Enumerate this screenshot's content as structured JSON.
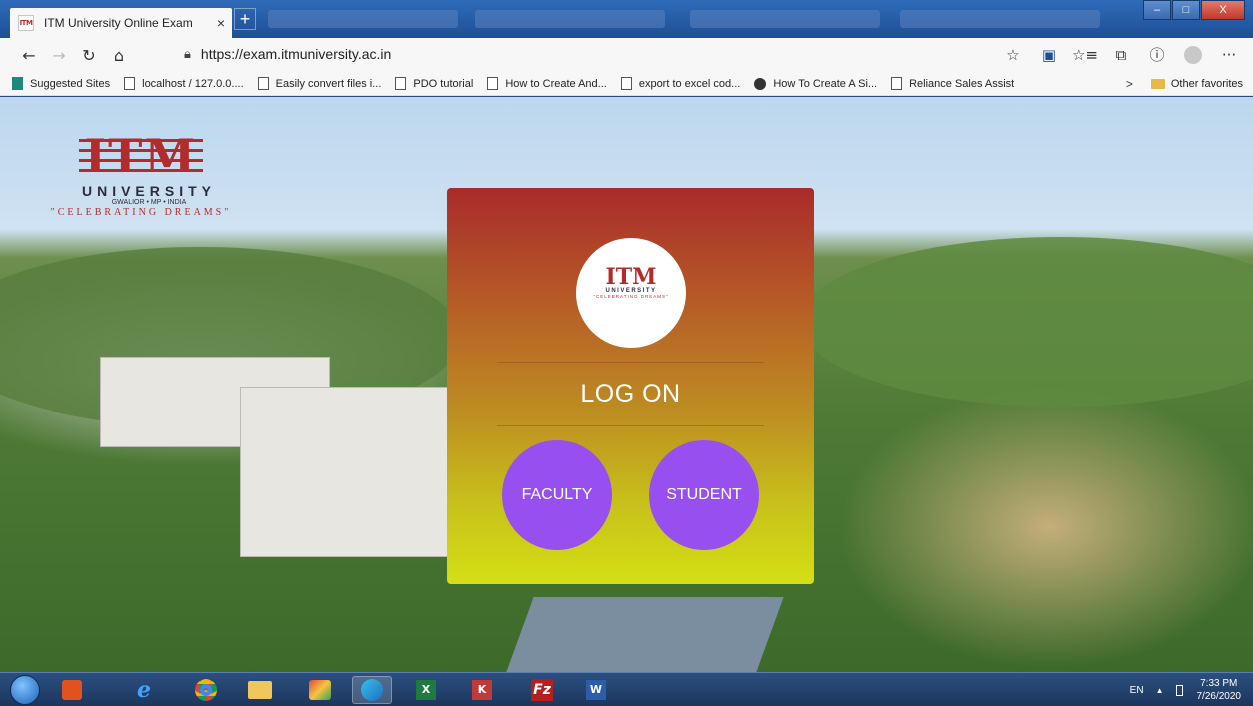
{
  "browser": {
    "tab": {
      "favicon_text": "ITM",
      "title": "ITM University Online Exam",
      "close": "×"
    },
    "new_tab": "+",
    "url": "https://exam.itmuniversity.ac.in",
    "nav": {
      "back": "←",
      "forward": "→",
      "refresh": "↻",
      "home": "⌂",
      "lock": "🔒"
    },
    "toolbar_icons": {
      "star": "☆",
      "collections": "⧉",
      "more": "···"
    },
    "window_controls": {
      "minimize": "–",
      "maximize": "□",
      "close": "X"
    }
  },
  "favorites": {
    "items": [
      {
        "label": "Suggested Sites",
        "icon": "bing"
      },
      {
        "label": "localhost / 127.0.0....",
        "icon": "page"
      },
      {
        "label": "Easily convert files i...",
        "icon": "page"
      },
      {
        "label": "PDO tutorial",
        "icon": "page"
      },
      {
        "label": "How to Create And...",
        "icon": "page"
      },
      {
        "label": "export to excel cod...",
        "icon": "page"
      },
      {
        "label": "How To Create A Si...",
        "icon": "dot"
      },
      {
        "label": "Reliance Sales Assist",
        "icon": "page"
      }
    ],
    "overflow": ">",
    "other": "Other favorites"
  },
  "page": {
    "logo": {
      "mark": "ITM",
      "name": "UNIVERSITY",
      "location": "GWALIOR • MP • INDIA",
      "tagline": "\"CELEBRATING DREAMS\""
    },
    "card": {
      "logo_mark": "ITM",
      "logo_name": "UNIVERSITY",
      "logo_tagline": "\"CELEBRATING DREAMS\"",
      "heading": "LOG ON",
      "faculty": "FACULTY",
      "student": "STUDENT"
    }
  },
  "taskbar": {
    "apps": [
      "media",
      "ie",
      "chrome",
      "explorer",
      "paint",
      "edge",
      "excel",
      "filezilla-k",
      "filezilla",
      "word"
    ],
    "language": "EN",
    "tray_arrow": "▲",
    "time": "7:33 PM",
    "date": "7/26/2020"
  },
  "colors": {
    "card_top": "#a92b2b",
    "card_bottom": "#d4df14",
    "button": "#9750ef",
    "brand_red": "#b22c2c"
  }
}
